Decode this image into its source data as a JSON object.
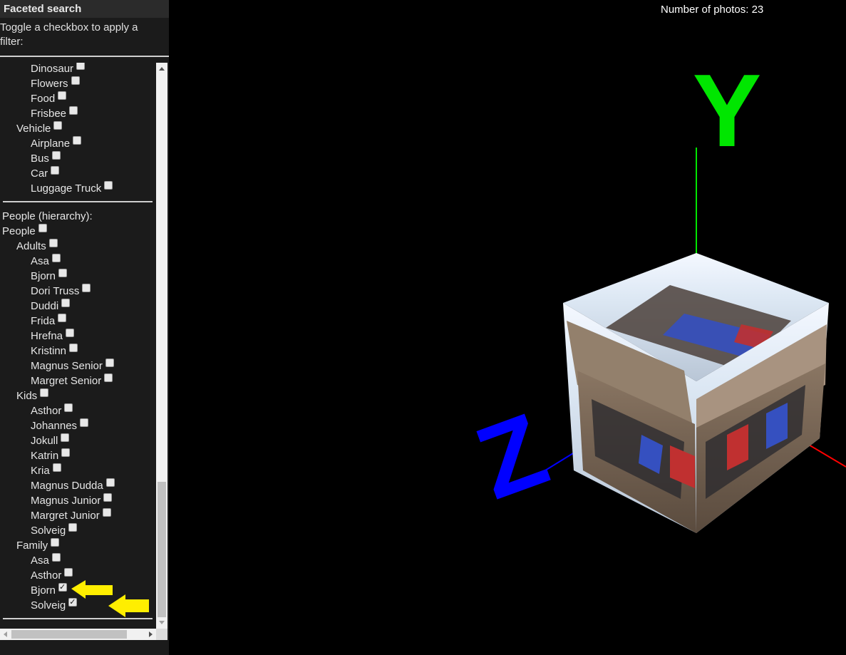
{
  "sidebar": {
    "title": "Faceted search",
    "instructions": "Toggle a checkbox to apply a filter:",
    "upper_items": [
      {
        "label": "Dinosaur",
        "checked": false,
        "level": 2
      },
      {
        "label": "Flowers",
        "checked": false,
        "level": 2
      },
      {
        "label": "Food",
        "checked": false,
        "level": 2
      },
      {
        "label": "Frisbee",
        "checked": false,
        "level": 2
      },
      {
        "label": "Vehicle",
        "checked": false,
        "level": 1
      },
      {
        "label": "Airplane",
        "checked": false,
        "level": 2
      },
      {
        "label": "Bus",
        "checked": false,
        "level": 2
      },
      {
        "label": "Car",
        "checked": false,
        "level": 2
      },
      {
        "label": "Luggage Truck",
        "checked": false,
        "level": 2
      }
    ],
    "people_heading": "People (hierarchy):",
    "people_items": [
      {
        "label": "People",
        "checked": false,
        "level": 0
      },
      {
        "label": "Adults",
        "checked": false,
        "level": 1
      },
      {
        "label": "Asa",
        "checked": false,
        "level": 2
      },
      {
        "label": "Bjorn",
        "checked": false,
        "level": 2
      },
      {
        "label": "Dori Truss",
        "checked": false,
        "level": 2
      },
      {
        "label": "Duddi",
        "checked": false,
        "level": 2
      },
      {
        "label": "Frida",
        "checked": false,
        "level": 2
      },
      {
        "label": "Hrefna",
        "checked": false,
        "level": 2
      },
      {
        "label": "Kristinn",
        "checked": false,
        "level": 2
      },
      {
        "label": "Magnus Senior",
        "checked": false,
        "level": 2
      },
      {
        "label": "Margret Senior",
        "checked": false,
        "level": 2
      },
      {
        "label": "Kids",
        "checked": false,
        "level": 1
      },
      {
        "label": "Asthor",
        "checked": false,
        "level": 2
      },
      {
        "label": "Johannes",
        "checked": false,
        "level": 2
      },
      {
        "label": "Jokull",
        "checked": false,
        "level": 2
      },
      {
        "label": "Katrin",
        "checked": false,
        "level": 2
      },
      {
        "label": "Kria",
        "checked": false,
        "level": 2
      },
      {
        "label": "Magnus Dudda",
        "checked": false,
        "level": 2
      },
      {
        "label": "Magnus Junior",
        "checked": false,
        "level": 2
      },
      {
        "label": "Margret Junior",
        "checked": false,
        "level": 2
      },
      {
        "label": "Solveig",
        "checked": false,
        "level": 2
      },
      {
        "label": "Family",
        "checked": false,
        "level": 1
      },
      {
        "label": "Asa",
        "checked": false,
        "level": 2
      },
      {
        "label": "Asthor",
        "checked": false,
        "level": 2
      },
      {
        "label": "Bjorn",
        "checked": true,
        "level": 2
      },
      {
        "label": "Solveig",
        "checked": true,
        "level": 2
      }
    ]
  },
  "viewer": {
    "photo_count_text": "Number of photos: 23",
    "axis_y_label": "Y",
    "axis_z_label": "Z",
    "colors": {
      "axis_x": "#ff0000",
      "axis_y": "#00e600",
      "axis_z": "#0000ff",
      "highlight_arrow": "#ffee00"
    }
  }
}
